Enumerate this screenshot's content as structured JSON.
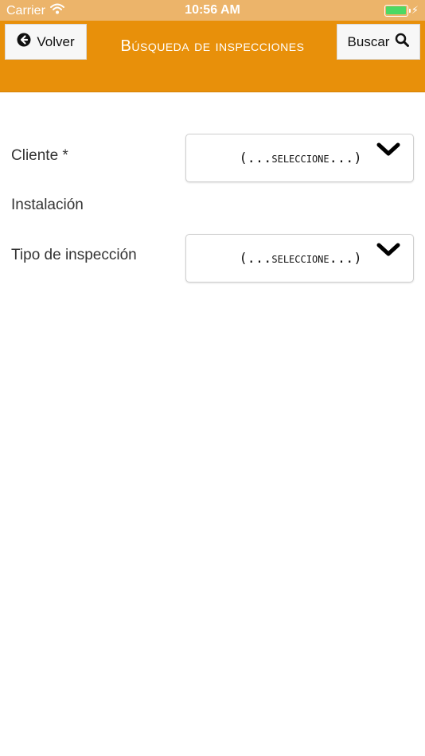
{
  "status_bar": {
    "carrier": "Carrier",
    "time": "10:56 AM",
    "battery_level": 1.0
  },
  "nav": {
    "back_label": "Volver",
    "title": "Búsqueda de inspecciones",
    "search_label": "Buscar"
  },
  "form": {
    "cliente": {
      "label": "Cliente *",
      "value": "(...seleccione...)"
    },
    "instalacion": {
      "label": "Instalación"
    },
    "tipo": {
      "label": "Tipo de inspección",
      "value": "(...seleccione...)"
    }
  },
  "colors": {
    "nav_background": "#e8900a",
    "status_background": "#ecb46a",
    "battery_green": "#4cd964"
  },
  "icons": {
    "back": "arrow-circle-left-icon",
    "search": "magnifier-icon",
    "dropdown": "chevron-down-icon",
    "wifi": "wifi-icon",
    "battery": "battery-icon",
    "charging": "bolt-icon"
  }
}
